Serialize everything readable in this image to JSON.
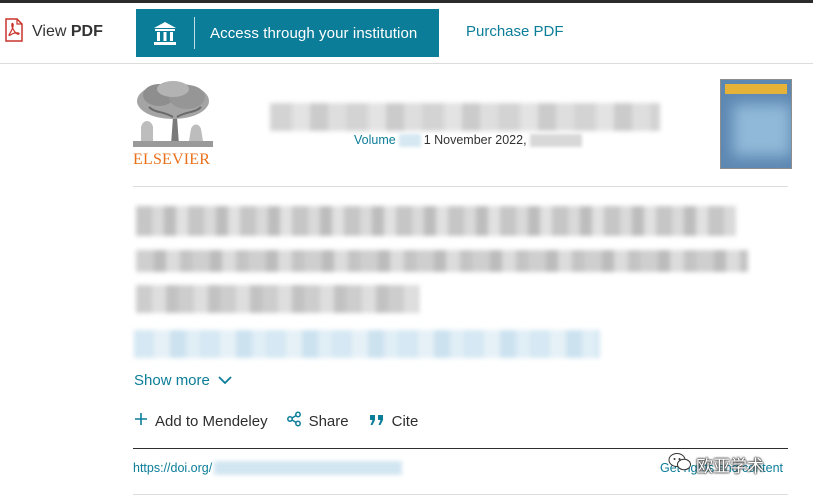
{
  "toolbar": {
    "view_pdf_prefix": "View",
    "view_pdf_bold": "PDF",
    "access_label": "Access through your institution",
    "purchase_label": "Purchase PDF"
  },
  "header": {
    "publisher_wordmark": "ELSEVIER",
    "volume_label": "Volume",
    "issue_date": "1 November 2022,"
  },
  "article": {
    "show_more_label": "Show more",
    "actions": {
      "mendeley_label": "Add to Mendeley",
      "share_label": "Share",
      "cite_label": "Cite"
    },
    "doi_prefix": "https://doi.org/",
    "rights_label": "Get rights and content"
  },
  "watermark": {
    "text": "欧亚学术"
  },
  "colors": {
    "accent": "#0c7d99",
    "elsevier_orange": "#e9711c",
    "cover_blue": "#5d88b2",
    "cover_bar": "#e7b336"
  },
  "icons": [
    "pdf-icon",
    "institution-icon",
    "chevron-down-icon",
    "plus-icon",
    "share-icon",
    "quote-icon",
    "wechat-icon"
  ]
}
